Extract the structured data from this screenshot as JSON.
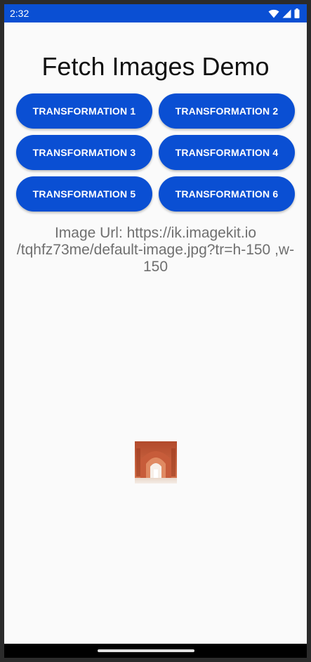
{
  "status_bar": {
    "time": "2:32",
    "icons": [
      "wifi-icon",
      "signal-icon",
      "battery-icon"
    ],
    "color": "#0a4fd3"
  },
  "title": "Fetch Images Demo",
  "buttons": [
    {
      "label": "TRANSFORMATION 1"
    },
    {
      "label": "TRANSFORMATION 2"
    },
    {
      "label": "TRANSFORMATION 3"
    },
    {
      "label": "TRANSFORMATION 4"
    },
    {
      "label": "TRANSFORMATION 5"
    },
    {
      "label": "TRANSFORMATION 6"
    }
  ],
  "image_url_text": "Image Url: https://ik.imagekit.io /tqhfz73me/default-image.jpg?tr=h-150 ,w-150",
  "accent_color": "#0a4fd3"
}
